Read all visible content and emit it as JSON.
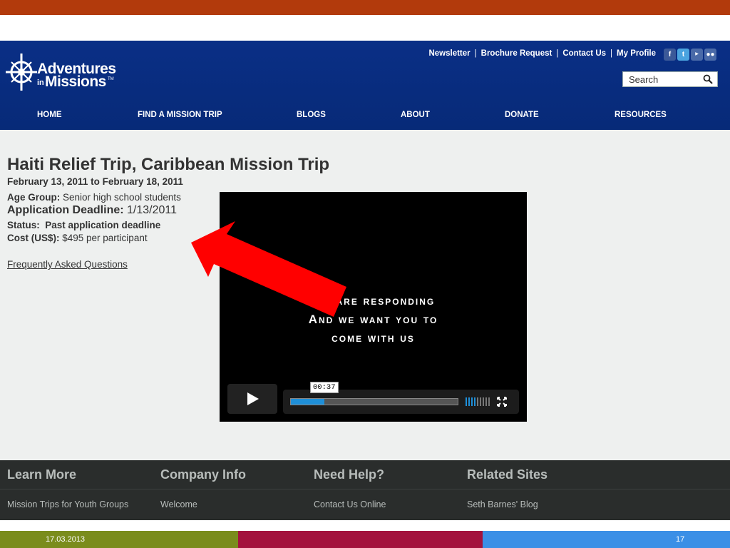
{
  "colors": {
    "top_bar": "#b23a0c",
    "header_blue": "#0a2f86",
    "arrow_red": "#ff0000",
    "bar_olive": "#7a8c1c",
    "bar_crimson": "#a3123d",
    "bar_blue": "#3b8fe6",
    "progress_blue": "#1f8fd8"
  },
  "logo": {
    "line1": "Adventures",
    "line2_in": "in",
    "line2": "Missions",
    "tm": "TM"
  },
  "utility_nav": [
    "Newsletter",
    "Brochure Request",
    "Contact Us",
    "My Profile"
  ],
  "social_icons": [
    "facebook-icon",
    "twitter-icon",
    "youtube-icon",
    "flickr-icon"
  ],
  "search": {
    "placeholder": "Search"
  },
  "main_nav": [
    "HOME",
    "FIND A MISSION TRIP",
    "BLOGS",
    "ABOUT",
    "DONATE",
    "RESOURCES"
  ],
  "trip": {
    "title": "Haiti Relief Trip, Caribbean Mission Trip",
    "dates": "February 13, 2011 to February 18, 2011",
    "age_label": "Age Group:",
    "age_value": " Senior high school students",
    "deadline_label": "Application Deadline:",
    "deadline_value": " 1/13/2011",
    "status_label": "Status:",
    "status_value": "  Past application deadline",
    "cost_label": "Cost (US$):",
    "cost_value": " $495 per participant",
    "faq": "Frequently Asked Questions"
  },
  "video": {
    "caption_lines": [
      "We are responding",
      "And we want you to",
      "come with us"
    ],
    "time": "00:37",
    "progress_percent": 20
  },
  "footer": {
    "columns": [
      {
        "heading": "Learn More",
        "link": "Mission Trips for Youth Groups"
      },
      {
        "heading": "Company Info",
        "link": "Welcome"
      },
      {
        "heading": "Need Help?",
        "link": "Contact Us Online"
      },
      {
        "heading": "Related Sites",
        "link": "Seth Barnes' Blog"
      }
    ]
  },
  "slide": {
    "date": "17.03.2013",
    "number": "17"
  }
}
